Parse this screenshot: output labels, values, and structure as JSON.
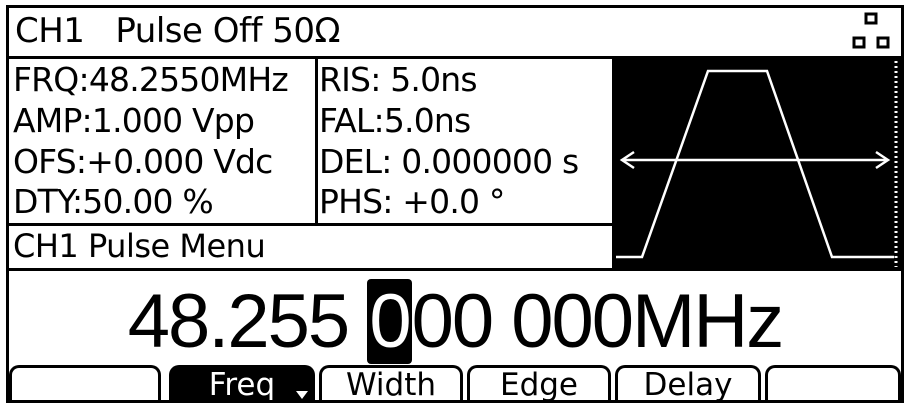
{
  "status_bar": {
    "channel": "CH1",
    "mode": "Pulse Off 50Ω"
  },
  "params": {
    "left": [
      {
        "label": "FRQ:",
        "value": "48.2550MHz"
      },
      {
        "label": "AMP:",
        "value": "1.000 Vpp"
      },
      {
        "label": "OFS:",
        "value": "+0.000 Vdc"
      },
      {
        "label": "DTY:",
        "value": "50.00 %"
      }
    ],
    "right": [
      {
        "label": "RIS:",
        "value": " 5.0ns"
      },
      {
        "label": "FAL:",
        "value": "5.0ns"
      },
      {
        "label": "DEL:",
        "value": " 0.000000 s"
      },
      {
        "label": "PHS:",
        "value": " +0.0 °"
      }
    ]
  },
  "menu_title": "CH1 Pulse Menu",
  "entry": {
    "before_cursor": "48.255 ",
    "cursor_digit": "0",
    "after_cursor": "00 000",
    "unit": "MHz"
  },
  "softkeys": [
    {
      "label": "",
      "active": false
    },
    {
      "label": "Freq",
      "active": true
    },
    {
      "label": "Width",
      "active": false
    },
    {
      "label": "Edge",
      "active": false
    },
    {
      "label": "Delay",
      "active": false
    },
    {
      "label": "",
      "active": false
    }
  ],
  "icons": {
    "network": "network-icon",
    "waveform": "pulse-waveform-preview"
  },
  "colors": {
    "foreground": "#000000",
    "background": "#ffffff"
  }
}
